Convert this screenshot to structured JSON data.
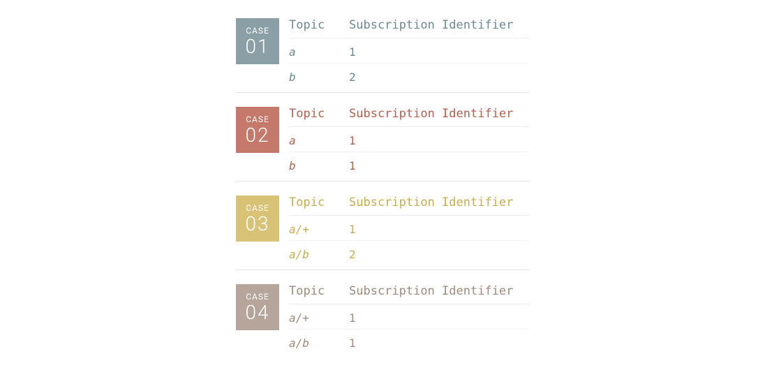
{
  "cases": [
    {
      "badge_label": "CASE",
      "badge_number": "01",
      "header_topic": "Topic",
      "header_sub": "Subscription Identifier",
      "rows": [
        {
          "topic": "a",
          "sub": "1"
        },
        {
          "topic": "b",
          "sub": "2"
        }
      ]
    },
    {
      "badge_label": "CASE",
      "badge_number": "02",
      "header_topic": "Topic",
      "header_sub": "Subscription Identifier",
      "rows": [
        {
          "topic": "a",
          "sub": "1"
        },
        {
          "topic": "b",
          "sub": "1"
        }
      ]
    },
    {
      "badge_label": "CASE",
      "badge_number": "03",
      "header_topic": "Topic",
      "header_sub": "Subscription Identifier",
      "rows": [
        {
          "topic": "a/+",
          "sub": "1"
        },
        {
          "topic": "a/b",
          "sub": "2"
        }
      ]
    },
    {
      "badge_label": "CASE",
      "badge_number": "04",
      "header_topic": "Topic",
      "header_sub": "Subscription Identifier",
      "rows": [
        {
          "topic": "a/+",
          "sub": "1"
        },
        {
          "topic": "a/b",
          "sub": "1"
        }
      ]
    }
  ]
}
